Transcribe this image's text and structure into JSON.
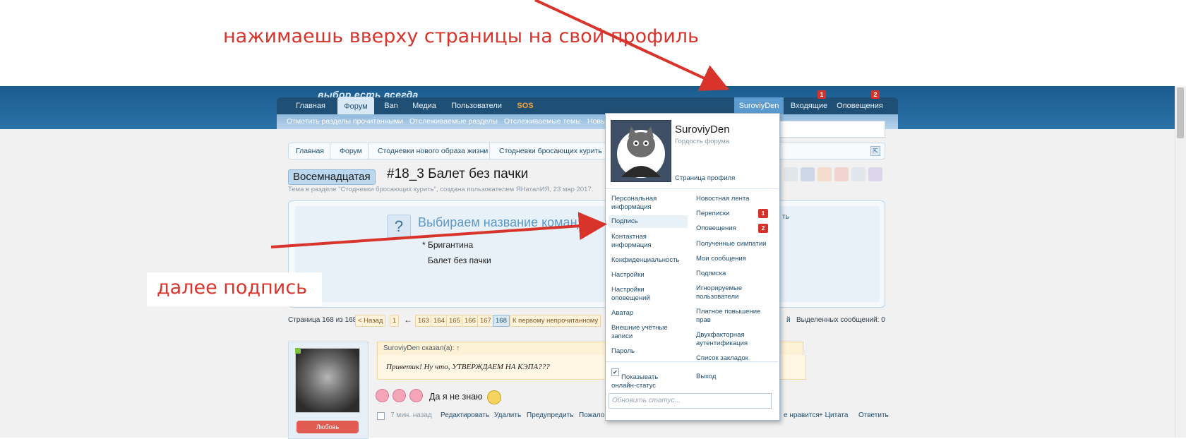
{
  "annotations": {
    "top": "нажимаешь вверху страницы на свой профиль",
    "left": "далее подпись"
  },
  "header": {
    "slogan": "выбор есть всегда"
  },
  "nav": {
    "tabs": [
      "Главная",
      "Форум",
      "Ban",
      "Медиа",
      "Пользователи",
      "SOS"
    ],
    "user": "SuroviyDen",
    "inbox": "Входящие",
    "inbox_count": "1",
    "alerts": "Оповещения",
    "alerts_count": "2"
  },
  "subnav": [
    "Отметить разделы прочитанными",
    "Отслеживаемые разделы",
    "Отслеживаемые темы",
    "Новые"
  ],
  "breadcrumb": [
    "Главная",
    "Форум",
    "Стодневки нового образа жизни",
    "Стодневки бросающих курить"
  ],
  "thread": {
    "prefix": "Восемнадцатая",
    "title": "#18_3 Балет без пачки",
    "desc": "Тема в разделе \"Стодневки бросающих курить\", создана пользователем ЯНаталИЯ, 23 мар 2017."
  },
  "poll": {
    "question": "Выбираем название команды",
    "options": [
      "* Бригантина",
      "Балет без пачки"
    ],
    "right_text": "ть"
  },
  "pagination": {
    "label": "Страница 168 из 168",
    "prev": "< Назад",
    "first": "1",
    "arrow": "←",
    "pages": [
      "163",
      "164",
      "165",
      "166",
      "167",
      "168"
    ],
    "unread": "К первому непрочитанному",
    "right_partial": "й",
    "selected": "Выделенных сообщений: 0"
  },
  "post": {
    "quote_author": "SuroviyDen сказал(а): ↑",
    "quote_text": "Приветик! Ну что, УТВЕРЖДАЕМ НА КЭПА???",
    "text": "Да я не знаю",
    "love": "Любовь",
    "time": "7 мин. назад",
    "actions": [
      "Редактировать",
      "Удалить",
      "Предупредить",
      "Пожалова"
    ],
    "right_actions": [
      "е нравится",
      "+ Цитата",
      "Ответить"
    ]
  },
  "dropdown": {
    "name": "SuroviyDen",
    "rank": "Гордость форума",
    "avatar_caption": "SuroviyDen",
    "profile_link": "Страница профиля",
    "left_items": [
      "Персональная информация",
      "Подпись",
      "Контактная информация",
      "Конфиденциальность",
      "Настройки",
      "Настройки оповещений",
      "Аватар",
      "Внешние учётные записи",
      "Пароль"
    ],
    "right_items": [
      "Новостная лента",
      "Переписки",
      "Оповещения",
      "Полученные симпатии",
      "Мои сообщения",
      "Подписка",
      "Игнорируемые пользователи",
      "Платное повышение прав",
      "Двухфакторная аутентификация",
      "Список закладок"
    ],
    "conversations_count": "1",
    "alerts_count": "2",
    "show_online": "Показывать онлайн-статус",
    "logout": "Выход",
    "status_placeholder": "Обновить статус..."
  },
  "colors": {
    "accent": "#1d4d70",
    "annotation": "#d8342c",
    "badge": "#d6322a"
  }
}
